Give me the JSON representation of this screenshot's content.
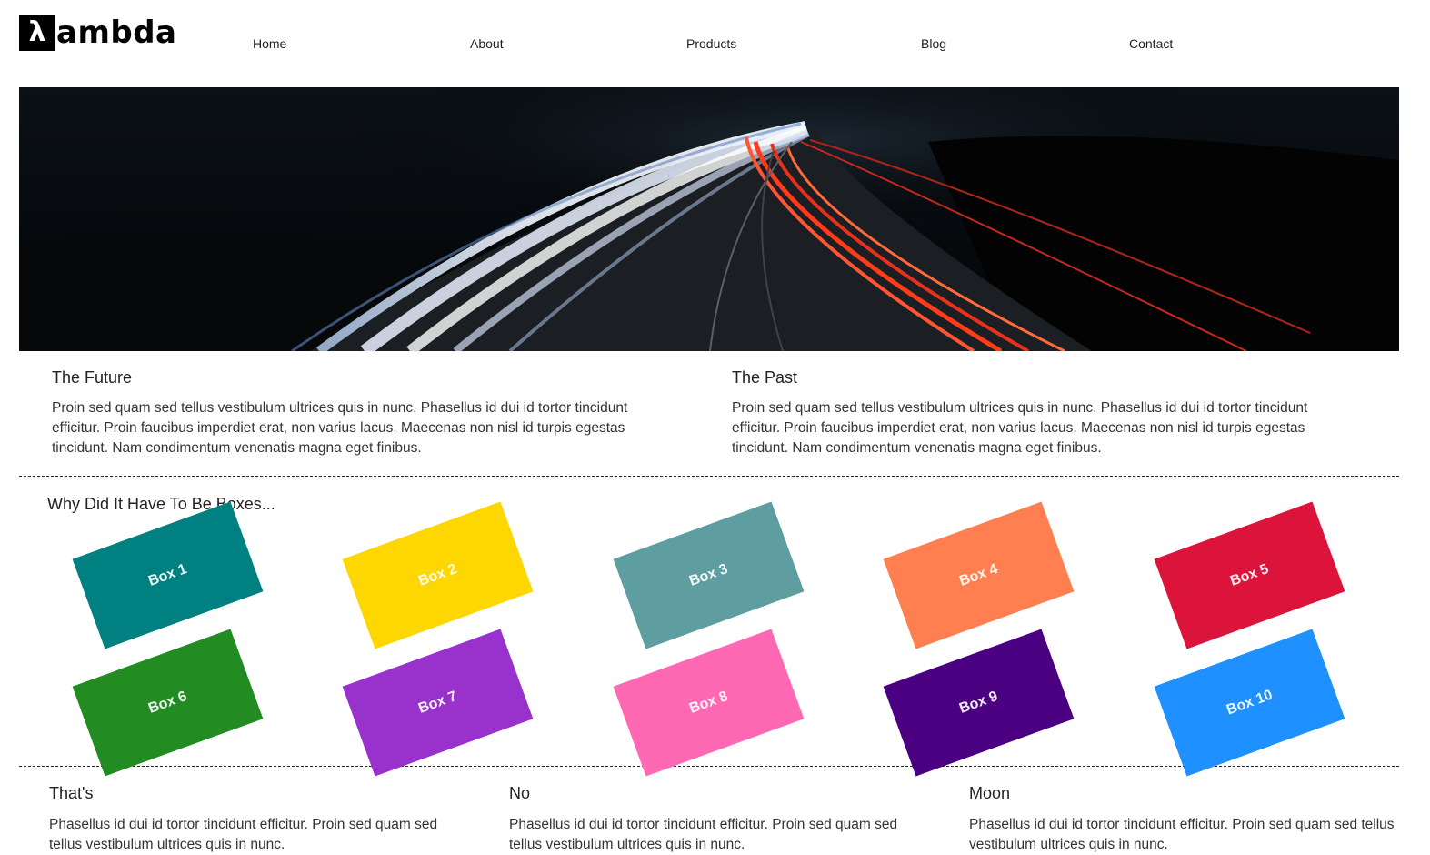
{
  "brand": {
    "mark": "λ",
    "rest": "ambda"
  },
  "nav": {
    "home": "Home",
    "about": "About",
    "products": "Products",
    "blog": "Blog",
    "contact": "Contact"
  },
  "columns": [
    {
      "title": "The Future",
      "text": "Proin sed quam sed tellus vestibulum ultrices quis in nunc. Phasellus id dui id tortor tincidunt efficitur. Proin faucibus imperdiet erat, non varius lacus. Maecenas non nisl id turpis egestas tincidunt. Nam condimentum venenatis magna eget finibus."
    },
    {
      "title": "The Past",
      "text": "Proin sed quam sed tellus vestibulum ultrices quis in nunc. Phasellus id dui id tortor tincidunt efficitur. Proin faucibus imperdiet erat, non varius lacus. Maecenas non nisl id turpis egestas tincidunt. Nam condimentum venenatis magna eget finibus."
    }
  ],
  "boxes_section": {
    "title": "Why Did It Have To Be Boxes...",
    "boxes": [
      {
        "label": "Box 1",
        "color": "#008080"
      },
      {
        "label": "Box 2",
        "color": "#FFD700"
      },
      {
        "label": "Box 3",
        "color": "#5F9EA0"
      },
      {
        "label": "Box 4",
        "color": "#FF7F50"
      },
      {
        "label": "Box 5",
        "color": "#DC143C"
      },
      {
        "label": "Box 6",
        "color": "#228B22"
      },
      {
        "label": "Box 7",
        "color": "#9932CC"
      },
      {
        "label": "Box 8",
        "color": "#FF69B4"
      },
      {
        "label": "Box 9",
        "color": "#4B0082"
      },
      {
        "label": "Box 10",
        "color": "#1E90FF"
      }
    ]
  },
  "bottom": [
    {
      "title": "That's",
      "text": "Phasellus id dui id tortor tincidunt efficitur. Proin sed quam sed tellus vestibulum ultrices quis in nunc."
    },
    {
      "title": "No",
      "text": "Phasellus id dui id tortor tincidunt efficitur. Proin sed quam sed tellus vestibulum ultrices quis in nunc."
    },
    {
      "title": "Moon",
      "text": "Phasellus id dui id tortor tincidunt efficitur. Proin sed quam sed tellus vestibulum ultrices quis in nunc."
    }
  ]
}
